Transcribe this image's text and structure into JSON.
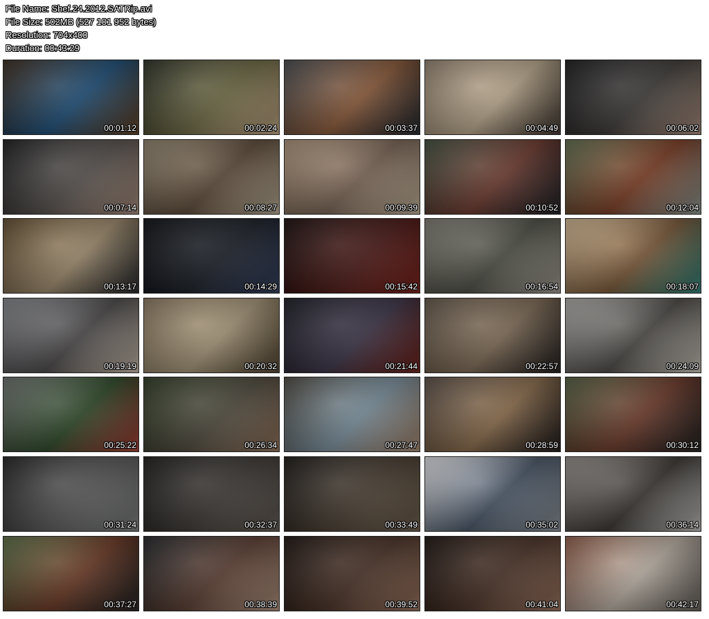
{
  "file_info": {
    "name": "File Name: Shef.24.2012.SATRip.avi",
    "size": "File Size: 502MB (527 101 952 bytes)",
    "resolution": "Resolution: 704x400",
    "duration": "Duration: 00:43:29"
  },
  "thumbnails": [
    {
      "time": "00:01:12",
      "colors": [
        "#3a2a1c",
        "#1f4f78",
        "#6b4a2b"
      ]
    },
    {
      "time": "00:02:24",
      "colors": [
        "#2b2f25",
        "#6e6a45",
        "#d0b490"
      ]
    },
    {
      "time": "00:03:37",
      "colors": [
        "#45484c",
        "#8a5a3a",
        "#2a3038"
      ]
    },
    {
      "time": "00:04:49",
      "colors": [
        "#8d7d6c",
        "#b9a88d",
        "#4a4038"
      ]
    },
    {
      "time": "00:06:02",
      "colors": [
        "#1d1d1f",
        "#3f3c3a",
        "#b89b8a"
      ]
    },
    {
      "time": "00:07:14",
      "colors": [
        "#1d1e20",
        "#57524f",
        "#b79a8a"
      ]
    },
    {
      "time": "00:08:27",
      "colors": [
        "#8a7f6a",
        "#5d4b3a",
        "#c9bca3"
      ]
    },
    {
      "time": "00:09:39",
      "colors": [
        "#a58e76",
        "#7a6556",
        "#d2c2a8"
      ]
    },
    {
      "time": "00:10:52",
      "colors": [
        "#3e4a3c",
        "#6d3b30",
        "#272a30"
      ]
    },
    {
      "time": "00:12:04",
      "colors": [
        "#5b6a4c",
        "#7c3e26",
        "#9aa7a0"
      ]
    },
    {
      "time": "00:13:17",
      "colors": [
        "#5e4a2f",
        "#9d8a6d",
        "#2e3033"
      ]
    },
    {
      "time": "00:14:29",
      "colors": [
        "#0e1013",
        "#1c2028",
        "#3c4a6a"
      ]
    },
    {
      "time": "00:15:42",
      "colors": [
        "#1a0f0e",
        "#4a1b18",
        "#8a2a24"
      ]
    },
    {
      "time": "00:16:54",
      "colors": [
        "#7c7870",
        "#4d4f45",
        "#b1aba0"
      ]
    },
    {
      "time": "00:18:07",
      "colors": [
        "#c9b18d",
        "#7b5a3a",
        "#3b8f86"
      ]
    },
    {
      "time": "00:19:19",
      "colors": [
        "#7f8185",
        "#4c4a4b",
        "#d6c8b8"
      ]
    },
    {
      "time": "00:20:32",
      "colors": [
        "#85745d",
        "#a59679",
        "#5e4f3b"
      ]
    },
    {
      "time": "00:21:44",
      "colors": [
        "#1b1c24",
        "#3c3548",
        "#7c2a22"
      ]
    },
    {
      "time": "00:22:57",
      "colors": [
        "#5f5447",
        "#7f6c57",
        "#2b2726"
      ]
    },
    {
      "time": "00:24:09",
      "colors": [
        "#a7a6a3",
        "#4d4a47",
        "#d9d4c9"
      ]
    },
    {
      "time": "00:25:22",
      "colors": [
        "#686c6a",
        "#2f4a2a",
        "#b4473d"
      ]
    },
    {
      "time": "00:26:34",
      "colors": [
        "#2f3a25",
        "#4f4b3f",
        "#a08068"
      ]
    },
    {
      "time": "00:27:47",
      "colors": [
        "#4a4740",
        "#7a8f9c",
        "#b4957a"
      ]
    },
    {
      "time": "00:28:59",
      "colors": [
        "#564c45",
        "#8a6c4c",
        "#262222"
      ]
    },
    {
      "time": "00:30:12",
      "colors": [
        "#4f5b3f",
        "#6d3b2b",
        "#2a2a2a"
      ]
    },
    {
      "time": "00:31:24",
      "colors": [
        "#232324",
        "#5a5a5b",
        "#8a8b8c"
      ]
    },
    {
      "time": "00:32:37",
      "colors": [
        "#1f1d1c",
        "#3e3a37",
        "#6f675f"
      ]
    },
    {
      "time": "00:33:49",
      "colors": [
        "#1c1a18",
        "#4a3f34",
        "#7a6a57"
      ]
    },
    {
      "time": "00:35:02",
      "colors": [
        "#d9d9dc",
        "#4a5768",
        "#9aa0a8"
      ]
    },
    {
      "time": "00:36:14",
      "colors": [
        "#8e8a86",
        "#3a3633",
        "#d2d0cd"
      ]
    },
    {
      "time": "00:37:27",
      "colors": [
        "#566a43",
        "#6b3a26",
        "#2a2a2a"
      ]
    },
    {
      "time": "00:38:39",
      "colors": [
        "#24262a",
        "#5b3f33",
        "#c2a08c"
      ]
    },
    {
      "time": "00:39:52",
      "colors": [
        "#1d1512",
        "#4a3328",
        "#a9806a"
      ]
    },
    {
      "time": "00:41:04",
      "colors": [
        "#1d1512",
        "#4a3328",
        "#a9806a"
      ]
    },
    {
      "time": "00:42:17",
      "colors": [
        "#8a5a47",
        "#b9afa4",
        "#6f6a64"
      ]
    }
  ]
}
